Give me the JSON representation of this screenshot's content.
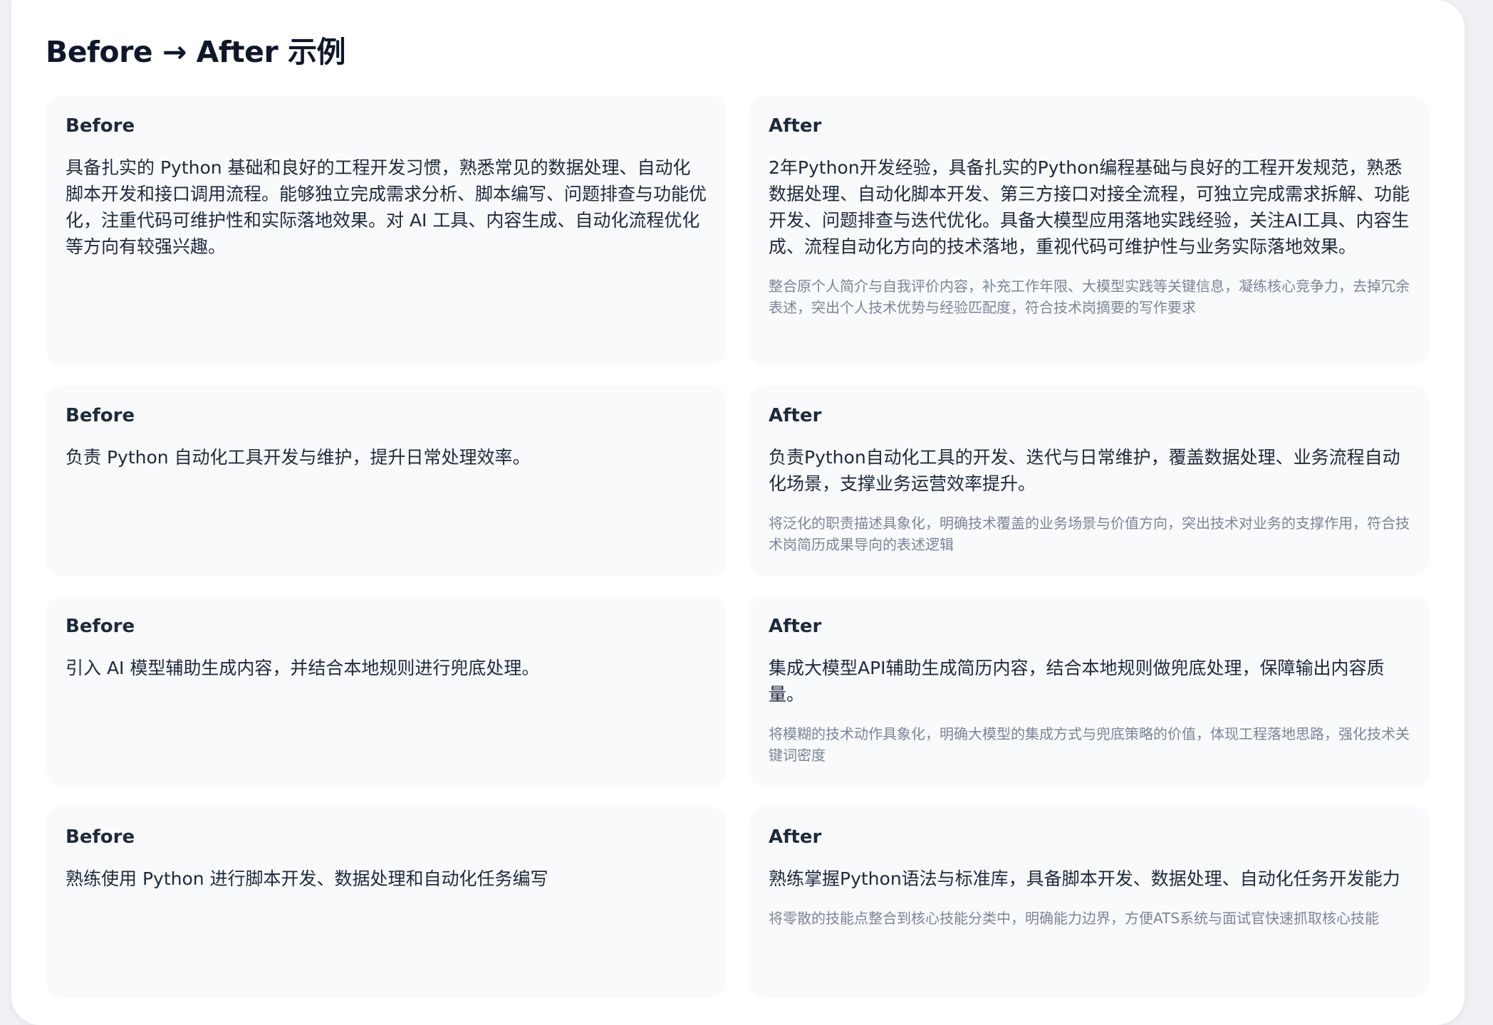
{
  "page": {
    "title": "Before → After 示例"
  },
  "examples": [
    {
      "before_label": "Before",
      "before_text": "具备扎实的 Python 基础和良好的工程开发习惯，熟悉常见的数据处理、自动化脚本开发和接口调用流程。能够独立完成需求分析、脚本编写、问题排查与功能优化，注重代码可维护性和实际落地效果。对 AI 工具、内容生成、自动化流程优化等方向有较强兴趣。",
      "after_label": "After",
      "after_text": "2年Python开发经验，具备扎实的Python编程基础与良好的工程开发规范，熟悉数据处理、自动化脚本开发、第三方接口对接全流程，可独立完成需求拆解、功能开发、问题排查与迭代优化。具备大模型应用落地实践经验，关注AI工具、内容生成、流程自动化方向的技术落地，重视代码可维护性与业务实际落地效果。",
      "note": "整合原个人简介与自我评价内容，补充工作年限、大模型实践等关键信息，凝练核心竞争力，去掉冗余表述，突出个人技术优势与经验匹配度，符合技术岗摘要的写作要求"
    },
    {
      "before_label": "Before",
      "before_text": "负责 Python 自动化工具开发与维护，提升日常处理效率。",
      "after_label": "After",
      "after_text": "负责Python自动化工具的开发、迭代与日常维护，覆盖数据处理、业务流程自动化场景，支撑业务运营效率提升。",
      "note": "将泛化的职责描述具象化，明确技术覆盖的业务场景与价值方向，突出技术对业务的支撑作用，符合技术岗简历成果导向的表述逻辑"
    },
    {
      "before_label": "Before",
      "before_text": "引入 AI 模型辅助生成内容，并结合本地规则进行兜底处理。",
      "after_label": "After",
      "after_text": "集成大模型API辅助生成简历内容，结合本地规则做兜底处理，保障输出内容质量。",
      "note": "将模糊的技术动作具象化，明确大模型的集成方式与兜底策略的价值，体现工程落地思路，强化技术关键词密度"
    },
    {
      "before_label": "Before",
      "before_text": "熟练使用 Python 进行脚本开发、数据处理和自动化任务编写",
      "after_label": "After",
      "after_text": "熟练掌握Python语法与标准库，具备脚本开发、数据处理、自动化任务开发能力",
      "note": "将零散的技能点整合到核心技能分类中，明确能力边界，方便ATS系统与面试官快速抓取核心技能"
    }
  ]
}
